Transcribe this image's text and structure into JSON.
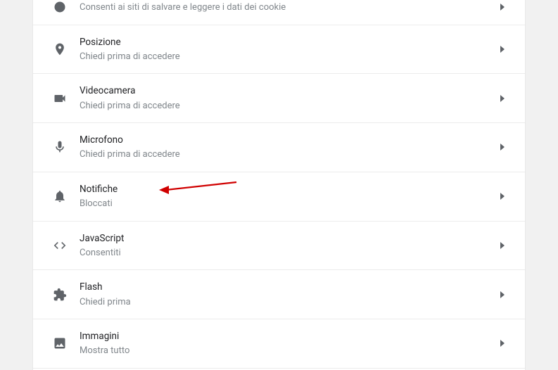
{
  "items": [
    {
      "id": "cookies",
      "icon": "cookie-icon",
      "title": "",
      "subtitle": "Consenti ai siti di salvare e leggere i dati dei cookie"
    },
    {
      "id": "location",
      "icon": "location-icon",
      "title": "Posizione",
      "subtitle": "Chiedi prima di accedere"
    },
    {
      "id": "camera",
      "icon": "camera-icon",
      "title": "Videocamera",
      "subtitle": "Chiedi prima di accedere"
    },
    {
      "id": "microphone",
      "icon": "microphone-icon",
      "title": "Microfono",
      "subtitle": "Chiedi prima di accedere"
    },
    {
      "id": "notifications",
      "icon": "bell-icon",
      "title": "Notifiche",
      "subtitle": "Bloccati"
    },
    {
      "id": "javascript",
      "icon": "code-icon",
      "title": "JavaScript",
      "subtitle": "Consentiti"
    },
    {
      "id": "flash",
      "icon": "plugin-icon",
      "title": "Flash",
      "subtitle": "Chiedi prima"
    },
    {
      "id": "images",
      "icon": "image-icon",
      "title": "Immagini",
      "subtitle": "Mostra tutto"
    }
  ]
}
